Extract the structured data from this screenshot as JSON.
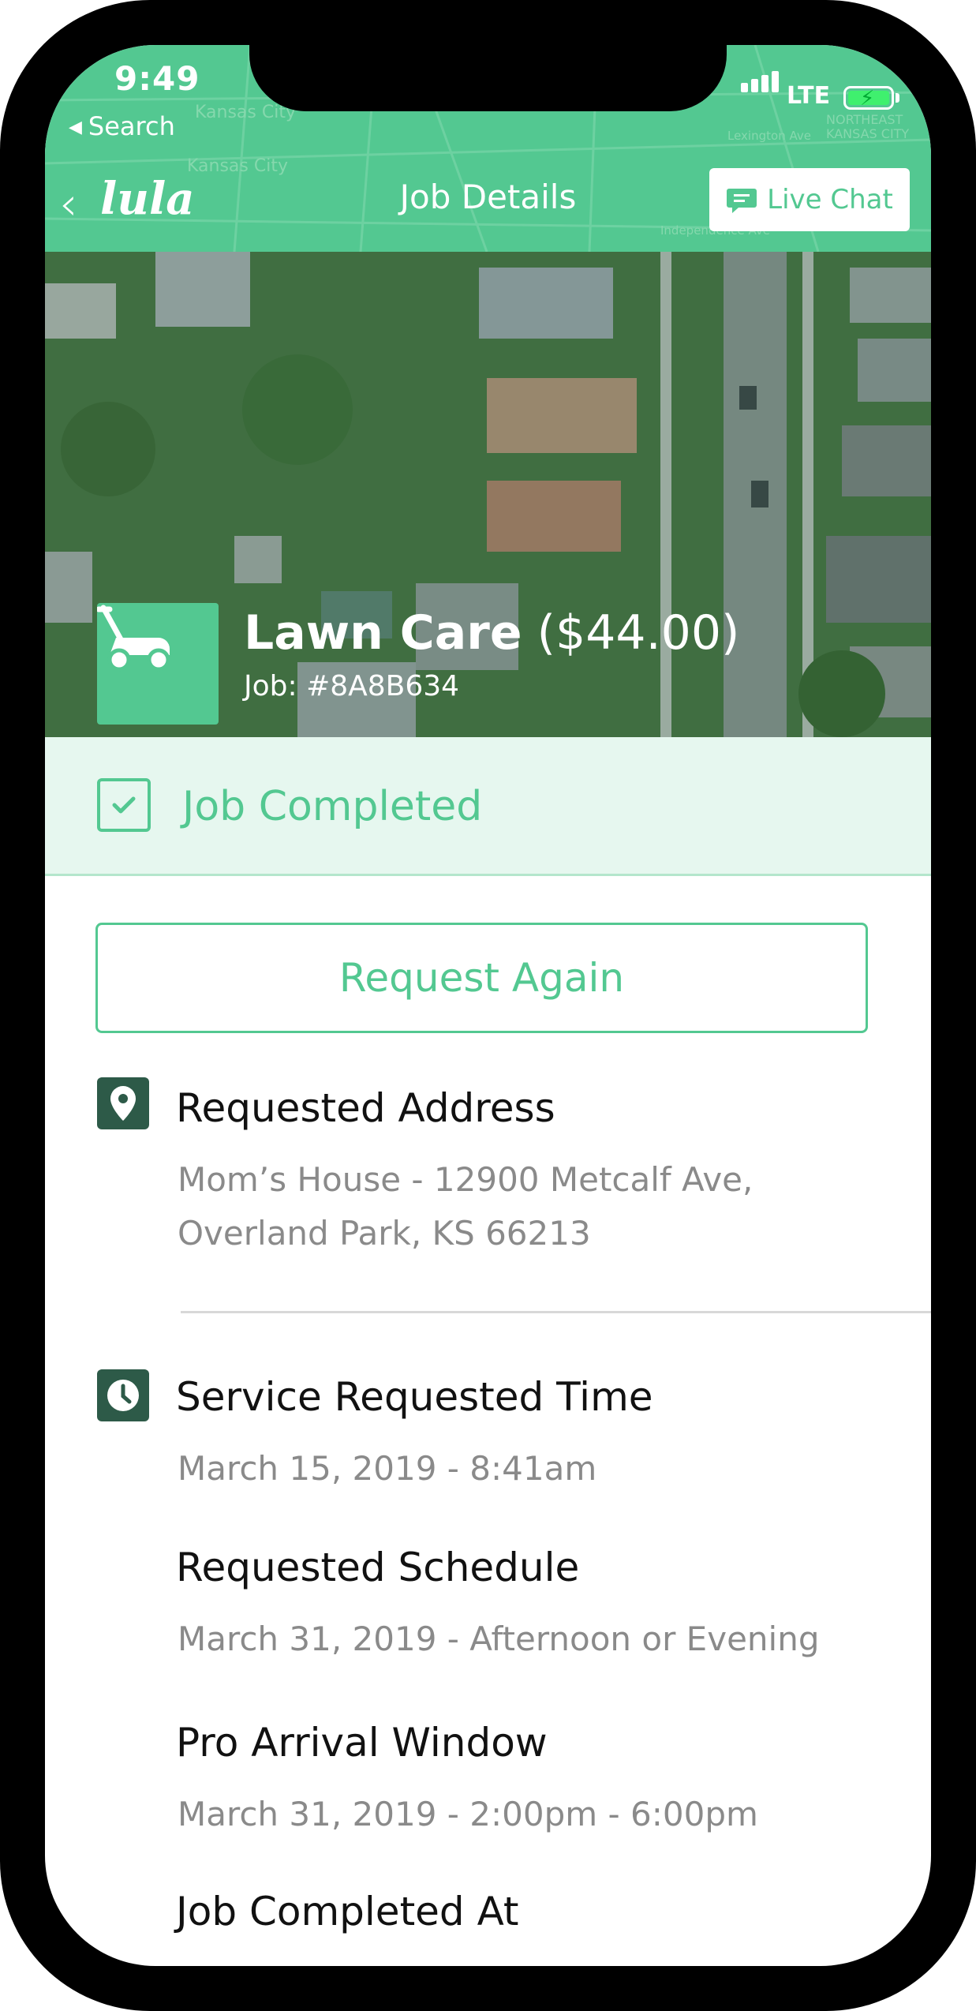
{
  "status_bar": {
    "time": "9:49",
    "back_label": "Search",
    "network": "LTE"
  },
  "header": {
    "logo": "lula",
    "title": "Job Details",
    "live_chat_label": "Live Chat"
  },
  "map_labels": [
    "Kansas City",
    "Kansas City",
    "NORTHEAST",
    "KANSAS CITY",
    "Lexington Ave",
    "Independence Ave"
  ],
  "job": {
    "service": "Lawn Care",
    "price": "($44.00)",
    "job_id": "Job: #8A8B634",
    "icon": "lawn-mower-icon"
  },
  "status": {
    "label": "Job Completed",
    "icon": "check-square-icon"
  },
  "actions": {
    "request_again": "Request Again"
  },
  "address": {
    "label": "Requested Address",
    "line1": "Mom’s House - 12900 Metcalf Ave,",
    "line2": "Overland Park, KS 66213",
    "icon": "location-pin-icon"
  },
  "times": {
    "icon": "clock-icon",
    "service_requested_label": "Service Requested Time",
    "service_requested_value": "March 15, 2019 - 8:41am",
    "schedule_label": "Requested Schedule",
    "schedule_value": "March 31, 2019 - Afternoon or Evening",
    "arrival_label": "Pro Arrival Window",
    "arrival_value": "March 31, 2019 - 2:00pm - 6:00pm",
    "completed_label": "Job Completed At"
  },
  "colors": {
    "brand": "#53c891",
    "banner_bg": "#e6f7ef",
    "icon_bg": "#2d5a48",
    "text": "#111111",
    "muted": "#8a8a8a"
  }
}
